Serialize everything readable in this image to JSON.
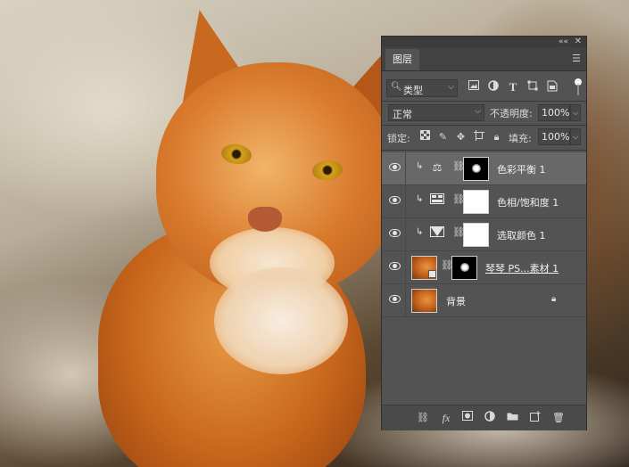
{
  "panel": {
    "tab_label": "图层",
    "filter": {
      "kind_label": "类型"
    },
    "blend": {
      "mode": "正常",
      "opacity_label": "不透明度:",
      "opacity_value": "100%"
    },
    "lock": {
      "label": "锁定:",
      "fill_label": "填充:",
      "fill_value": "100%"
    },
    "layers": [
      {
        "name": "色彩平衡 1",
        "adjustment_icon": "balance-icon",
        "mask": "black",
        "clipped": true,
        "selected": true
      },
      {
        "name": "色相/饱和度 1",
        "adjustment_icon": "hue-saturation-icon",
        "mask": "white",
        "clipped": true,
        "selected": false
      },
      {
        "name": "选取颜色 1",
        "adjustment_icon": "selective-color-icon",
        "mask": "white",
        "clipped": true,
        "selected": false
      },
      {
        "name": "琴琴 PS...素材 1",
        "type": "smart-object",
        "mask": "black",
        "selected": false
      },
      {
        "name": "背景",
        "type": "background",
        "locked": true,
        "selected": false
      }
    ],
    "bottom_icons": [
      "link-icon",
      "fx-icon",
      "add-mask-icon",
      "adjustment-layer-icon",
      "group-folder-icon",
      "new-layer-icon",
      "trash-icon"
    ],
    "bottom_fx_label": "fx"
  },
  "colors": {
    "panel_bg": "#535353",
    "selected_row": "#686868",
    "titlebar": "#3c3c3c"
  }
}
